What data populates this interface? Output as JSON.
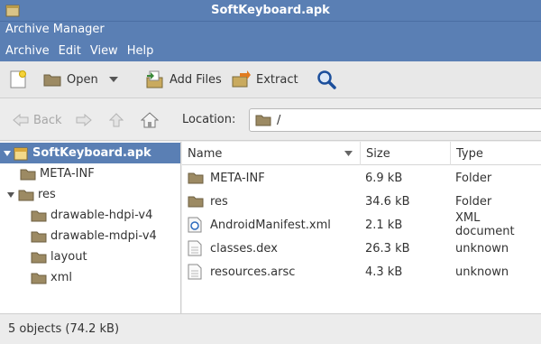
{
  "window": {
    "title": "SoftKeyboard.apk",
    "app_name": "Archive Manager"
  },
  "menus": [
    "Archive",
    "Edit",
    "View",
    "Help"
  ],
  "toolbar": {
    "open_label": "Open",
    "add_files_label": "Add Files",
    "extract_label": "Extract"
  },
  "nav": {
    "back_label": "Back",
    "location_label": "Location:",
    "location_value": "/"
  },
  "sidebar": {
    "items": [
      {
        "label": "SoftKeyboard.apk",
        "selected": true,
        "expanded": true
      },
      {
        "label": "META-INF"
      },
      {
        "label": "res",
        "expanded": true
      },
      {
        "label": "drawable-hdpi-v4"
      },
      {
        "label": "drawable-mdpi-v4"
      },
      {
        "label": "layout"
      },
      {
        "label": "xml"
      }
    ]
  },
  "table": {
    "columns": [
      "Name",
      "Size",
      "Type"
    ],
    "rows": [
      {
        "name": "META-INF",
        "size": "6.9 kB",
        "type": "Folder",
        "icon": "folder-icon"
      },
      {
        "name": "res",
        "size": "34.6 kB",
        "type": "Folder",
        "icon": "folder-icon"
      },
      {
        "name": "AndroidManifest.xml",
        "size": "2.1 kB",
        "type": "XML document",
        "icon": "xml-file-icon"
      },
      {
        "name": "classes.dex",
        "size": "26.3 kB",
        "type": "unknown",
        "icon": "file-icon"
      },
      {
        "name": "resources.arsc",
        "size": "4.3 kB",
        "type": "unknown",
        "icon": "file-icon"
      }
    ]
  },
  "status": "5 objects (74.2 kB)",
  "colors": {
    "accent": "#5a7fb4",
    "folder": "#8a7a5a"
  }
}
